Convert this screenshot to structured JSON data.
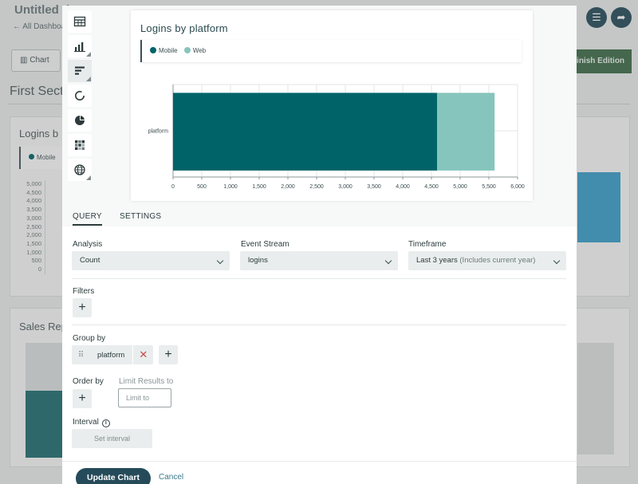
{
  "background": {
    "dashboard_title": "Untitled d",
    "back_link": "← All Dashboa",
    "chart_button": "Chart",
    "section_title": "First Sect",
    "card1_title": "Logins b",
    "card1_legend": "Mobile",
    "card1_yticks": [
      "5,000",
      "4,500",
      "4,000",
      "3,500",
      "3,000",
      "2,500",
      "2,000",
      "1,500",
      "1,000",
      "500",
      "0"
    ],
    "card2_title": "Sales Rep",
    "finish_button": "Finish Edition",
    "filter_icon": "sliders-icon",
    "share_icon": "share-arrow-icon"
  },
  "toolbar": {
    "items": [
      {
        "icon": "table-icon"
      },
      {
        "icon": "bar-chart-icon"
      },
      {
        "icon": "horizontal-bar-icon"
      },
      {
        "icon": "donut-icon"
      },
      {
        "icon": "pie-icon"
      },
      {
        "icon": "heatmap-icon"
      },
      {
        "icon": "globe-icon"
      }
    ]
  },
  "chart_data": {
    "type": "bar",
    "orientation": "horizontal",
    "stacked": true,
    "title": "Logins by platform",
    "categories": [
      "platform"
    ],
    "series": [
      {
        "name": "Mobile",
        "values": [
          4600
        ],
        "color": "#006368"
      },
      {
        "name": "Web",
        "values": [
          1000
        ],
        "color": "#86c5bd"
      }
    ],
    "xlim": [
      0,
      6000
    ],
    "xticks": [
      0,
      500,
      1000,
      1500,
      2000,
      2500,
      3000,
      3500,
      4000,
      4500,
      5000,
      5500,
      6000
    ],
    "xtick_labels": [
      "0",
      "500",
      "1,000",
      "1,500",
      "2,000",
      "2,500",
      "3,000",
      "3,500",
      "4,000",
      "4,500",
      "5,000",
      "5,500",
      "6,000"
    ],
    "grid": true,
    "legend_position": "top-left"
  },
  "tabs": {
    "query": "QUERY",
    "settings": "SETTINGS"
  },
  "form": {
    "analysis_label": "Analysis",
    "analysis_value": "Count",
    "event_stream_label": "Event Stream",
    "event_stream_value": "logins",
    "timeframe_label": "Timeframe",
    "timeframe_value": "Last 3 years",
    "timeframe_note": "(Includes current year)",
    "filters_label": "Filters",
    "group_by_label": "Group by",
    "group_by_chip": "platform",
    "order_by_label": "Order by",
    "limit_label": "Limit Results to",
    "limit_placeholder": "Limit to",
    "interval_label": "Interval",
    "interval_button": "Set interval"
  },
  "footer": {
    "update_button": "Update Chart",
    "cancel_link": "Cancel"
  }
}
